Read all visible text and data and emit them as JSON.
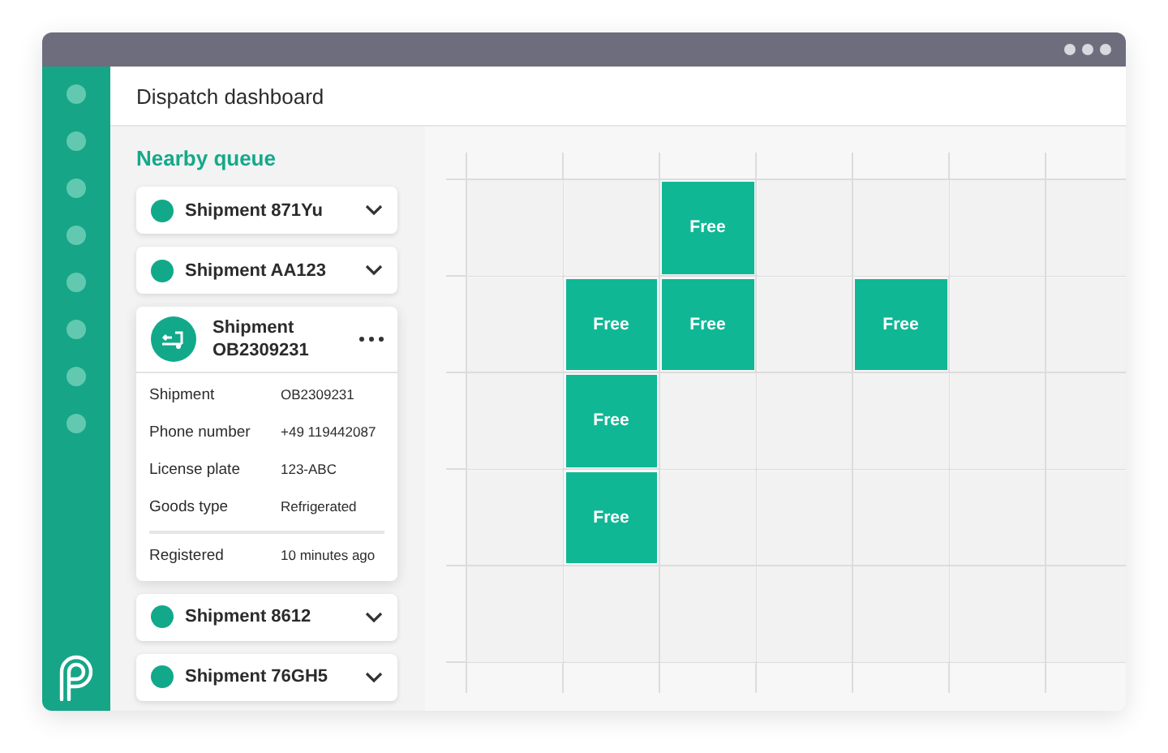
{
  "header": {
    "title": "Dispatch dashboard"
  },
  "queue": {
    "title": "Nearby queue",
    "shipments": [
      {
        "name": "Shipment 871Yu",
        "expanded": false
      },
      {
        "name": "Shipment AA123",
        "expanded": false
      },
      {
        "name": "Shipment OB2309231",
        "expanded": true,
        "details": [
          {
            "label": "Shipment",
            "value": "OB2309231"
          },
          {
            "label": "Phone number",
            "value": "+49 119442087"
          },
          {
            "label": "License plate",
            "value": "123-ABC"
          },
          {
            "label": "Goods type",
            "value": "Refrigerated"
          }
        ],
        "registered": {
          "label": "Registered",
          "value": "10 minutes ago"
        }
      },
      {
        "name": "Shipment 8612",
        "expanded": false
      },
      {
        "name": "Shipment 76GH5",
        "expanded": false
      }
    ]
  },
  "grid": {
    "rows": [
      [
        {
          "free": false
        },
        {
          "free": false
        },
        {
          "free": true,
          "label": "Free"
        },
        {
          "free": false
        },
        {
          "free": false
        },
        {
          "free": false
        },
        {
          "free": false
        }
      ],
      [
        {
          "free": false
        },
        {
          "free": true,
          "label": "Free"
        },
        {
          "free": true,
          "label": "Free"
        },
        {
          "free": false
        },
        {
          "free": true,
          "label": "Free"
        },
        {
          "free": false
        },
        {
          "free": false
        }
      ],
      [
        {
          "free": false
        },
        {
          "free": true,
          "label": "Free"
        },
        {
          "free": false
        },
        {
          "free": false
        },
        {
          "free": false
        },
        {
          "free": false
        },
        {
          "free": false
        }
      ],
      [
        {
          "free": false
        },
        {
          "free": true,
          "label": "Free"
        },
        {
          "free": false
        },
        {
          "free": false
        },
        {
          "free": false
        },
        {
          "free": false
        },
        {
          "free": false
        }
      ],
      [
        {
          "free": false
        },
        {
          "free": false
        },
        {
          "free": false
        },
        {
          "free": false
        },
        {
          "free": false
        },
        {
          "free": false
        },
        {
          "free": false
        }
      ]
    ]
  }
}
